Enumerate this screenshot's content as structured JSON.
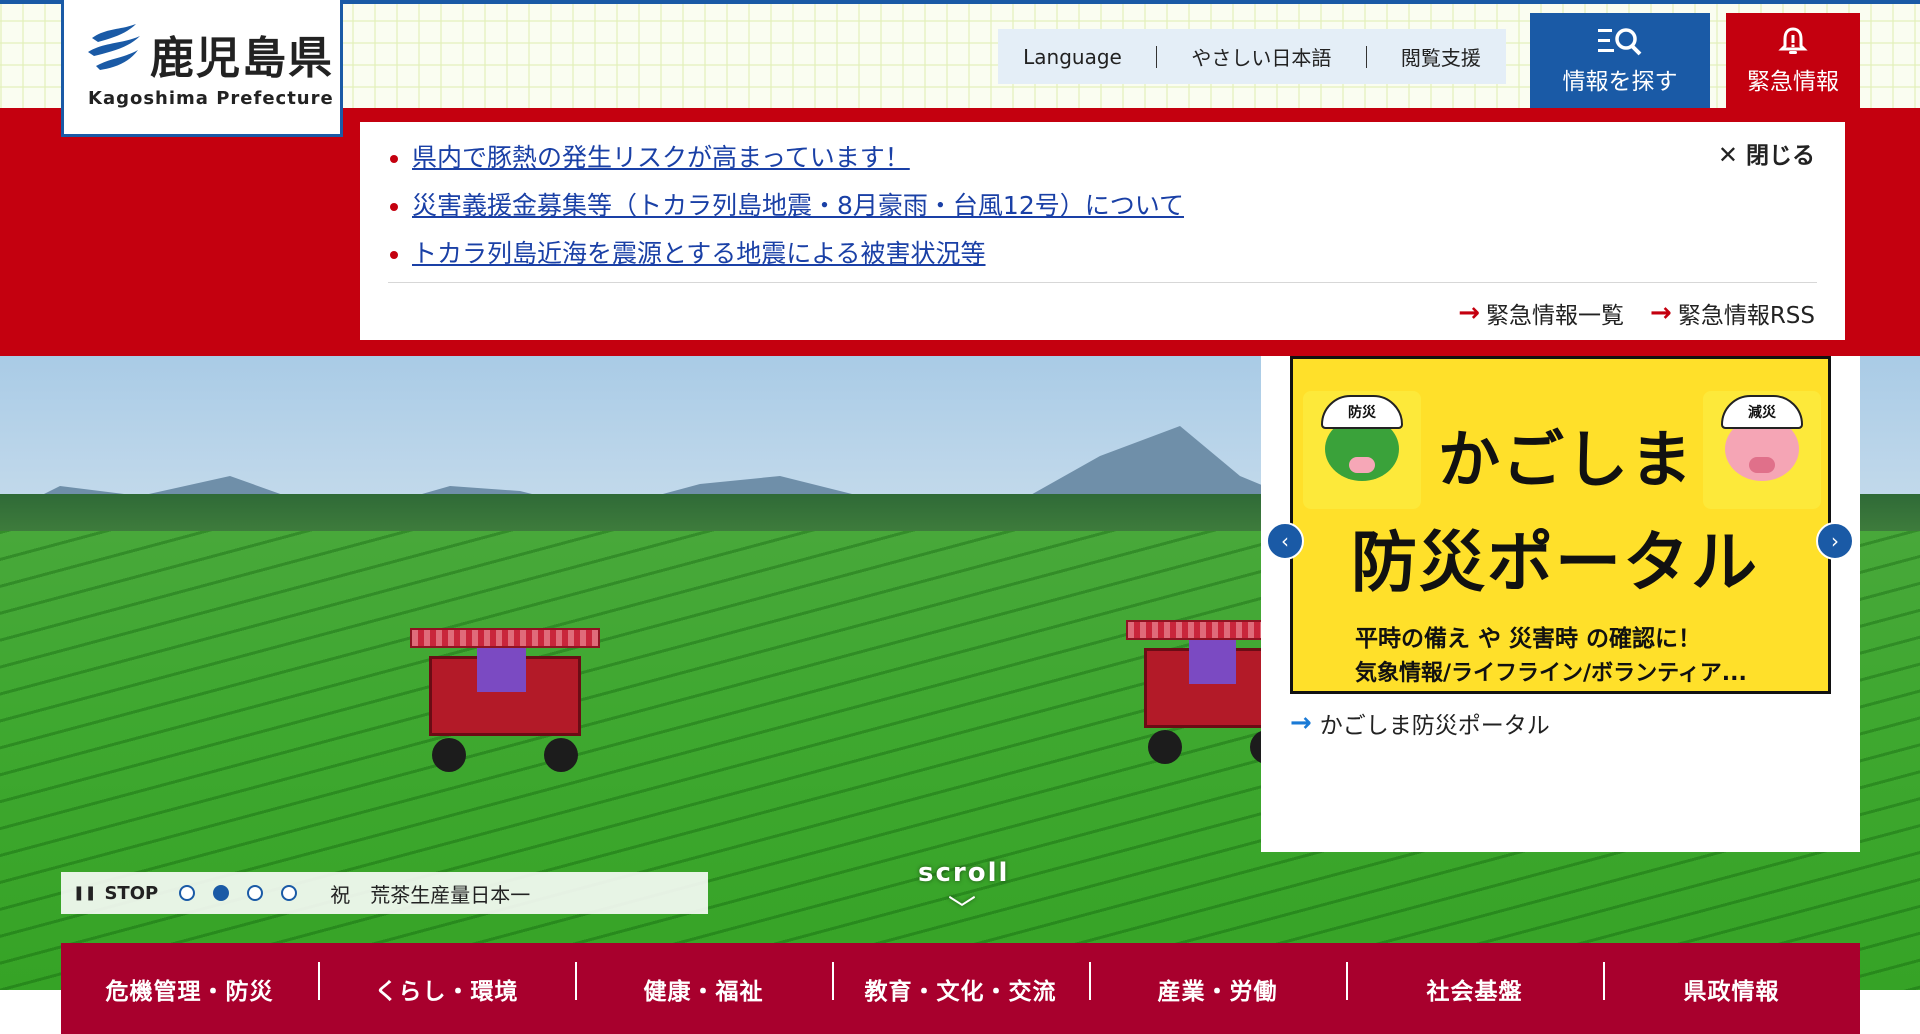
{
  "header": {
    "logo_jp": "鹿児島県",
    "logo_en": "Kagoshima Prefecture",
    "util_links": [
      "Language",
      "やさしい日本語",
      "閲覧支援"
    ],
    "search_button": "情報を探す",
    "emergency_button": "緊急情報"
  },
  "emergency_panel": {
    "items": [
      "県内で豚熱の発生リスクが高まっています！",
      "災害義援金募集等（トカラ列島地震・8月豪雨・台風12号）について",
      "トカラ列島近海を震源とする地震による被害状況等"
    ],
    "close_label": "閉じる",
    "links": [
      "緊急情報一覧",
      "緊急情報RSS"
    ]
  },
  "hero": {
    "stop_label": "STOP",
    "slide_count": 4,
    "active_slide": 2,
    "caption": "祝　荒茶生産量日本一",
    "scroll_label": "scroll"
  },
  "side_banner": {
    "mascot_left_badge": "防災",
    "mascot_right_badge": "減災",
    "title_line1": "かごしま",
    "title_line2": "防災ポータル",
    "sub_line1": "平時の備え や 災害時 の確認に！",
    "sub_line2": "気象情報/ライフライン/ボランティア...",
    "link_label": "かごしま防災ポータル"
  },
  "global_nav": [
    "危機管理・防災",
    "くらし・環境",
    "健康・福祉",
    "教育・文化・交流",
    "産業・労働",
    "社会基盤",
    "県政情報"
  ],
  "colors": {
    "brand_blue": "#1a5aa6",
    "emergency_red": "#c4000f",
    "nav_crimson": "#a8002d",
    "banner_yellow": "#ffe02a"
  },
  "icons": {
    "search": "search-list-icon",
    "emergency": "alert-bell-icon",
    "close": "close-icon",
    "arrow": "arrow-right-icon",
    "pause": "pause-icon",
    "prev": "chevron-left-icon",
    "next": "chevron-right-icon"
  }
}
